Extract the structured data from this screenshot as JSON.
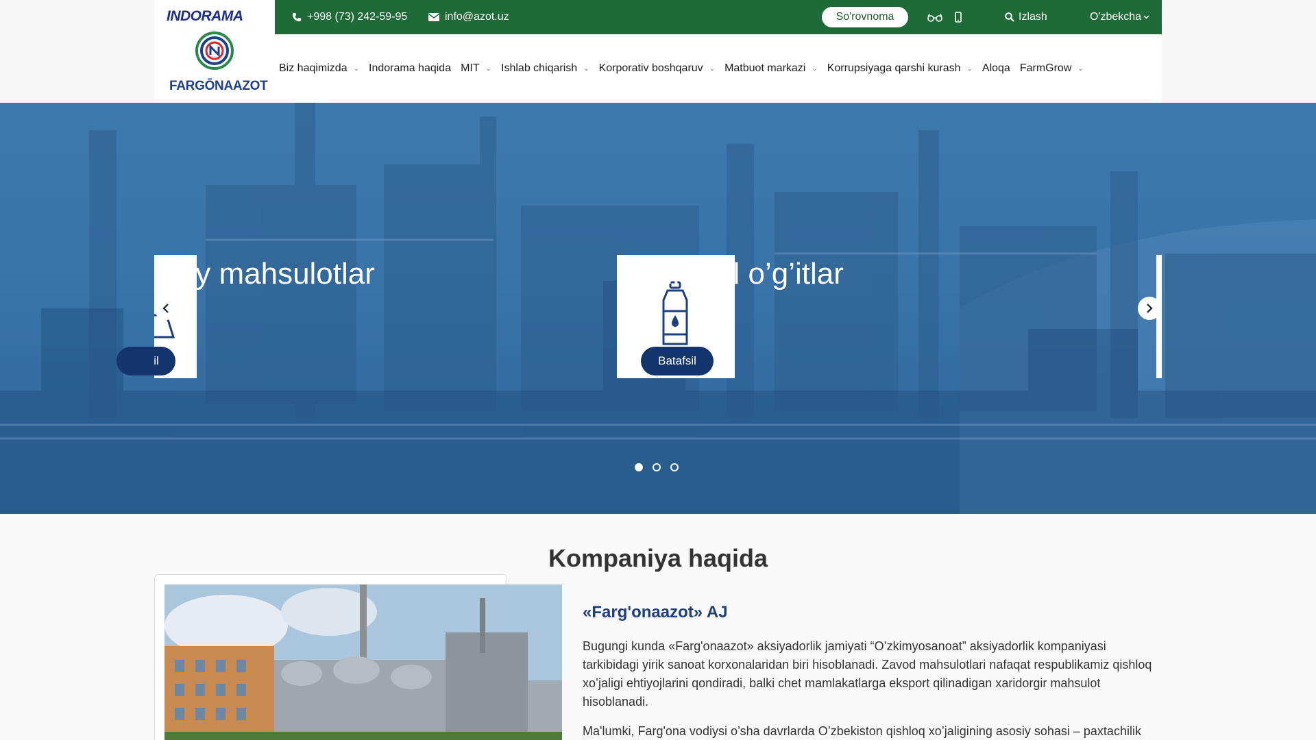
{
  "brand": {
    "indorama": "INDORAMA",
    "company_logo": "FARGŌNAAZOT",
    "colors": {
      "topbar": "#1f6b37",
      "hero": "#3a73a8",
      "button": "#14346e",
      "heading": "#1d3f80"
    }
  },
  "topbar": {
    "phone": "+998 (73) 242-59-95",
    "email": "info@azot.uz",
    "survey_label": "So'rovnoma",
    "search_label": "Izlash",
    "language": "O'zbekcha"
  },
  "nav": {
    "items": [
      {
        "label": "Biz haqimizda",
        "has_dropdown": true
      },
      {
        "label": "Indorama haqida",
        "has_dropdown": false
      },
      {
        "label": "MIT",
        "has_dropdown": true
      },
      {
        "label": "Ishlab chiqarish",
        "has_dropdown": true
      },
      {
        "label": "Korporativ boshqaruv",
        "has_dropdown": true
      },
      {
        "label": "Matbuot markazi",
        "has_dropdown": true
      },
      {
        "label": "Korrupsiyaga qarshi kurash",
        "has_dropdown": true
      },
      {
        "label": "Aloqa",
        "has_dropdown": false
      },
      {
        "label": "FarmGrow",
        "has_dropdown": true
      }
    ]
  },
  "hero": {
    "slides": [
      {
        "title": "yoviy mahsulotlar",
        "button": "il"
      },
      {
        "title": "Mineral o’g’itlar",
        "button": "Batafsil"
      }
    ],
    "active_slide": 1,
    "slide_count": 3
  },
  "company": {
    "section_title": "Kompaniya haqida",
    "name": "«Farg'onaazot» AJ",
    "paragraph1": "Bugungi kunda «Farg'onaazot» aksiyadorlik jamiyati “O’zkimyosanoat” aksiyadorlik kompaniyasi tarkibidagi yirik sanoat korxonalaridan biri hisoblanadi. Zavod mahsulotlari nafaqat respublikamiz qishloq xo’jaligi ehtiyojlarini qondiradi, balki chet mamlakatlarga eksport qilinadigan xaridorgir mahsulot hisoblanadi.",
    "paragraph2": "Ma'lumki, Farg'ona vodiysi o’sha davrlarda O’zbekiston qishloq xo’jaligining asosiy sohasi – paxtachilik"
  }
}
